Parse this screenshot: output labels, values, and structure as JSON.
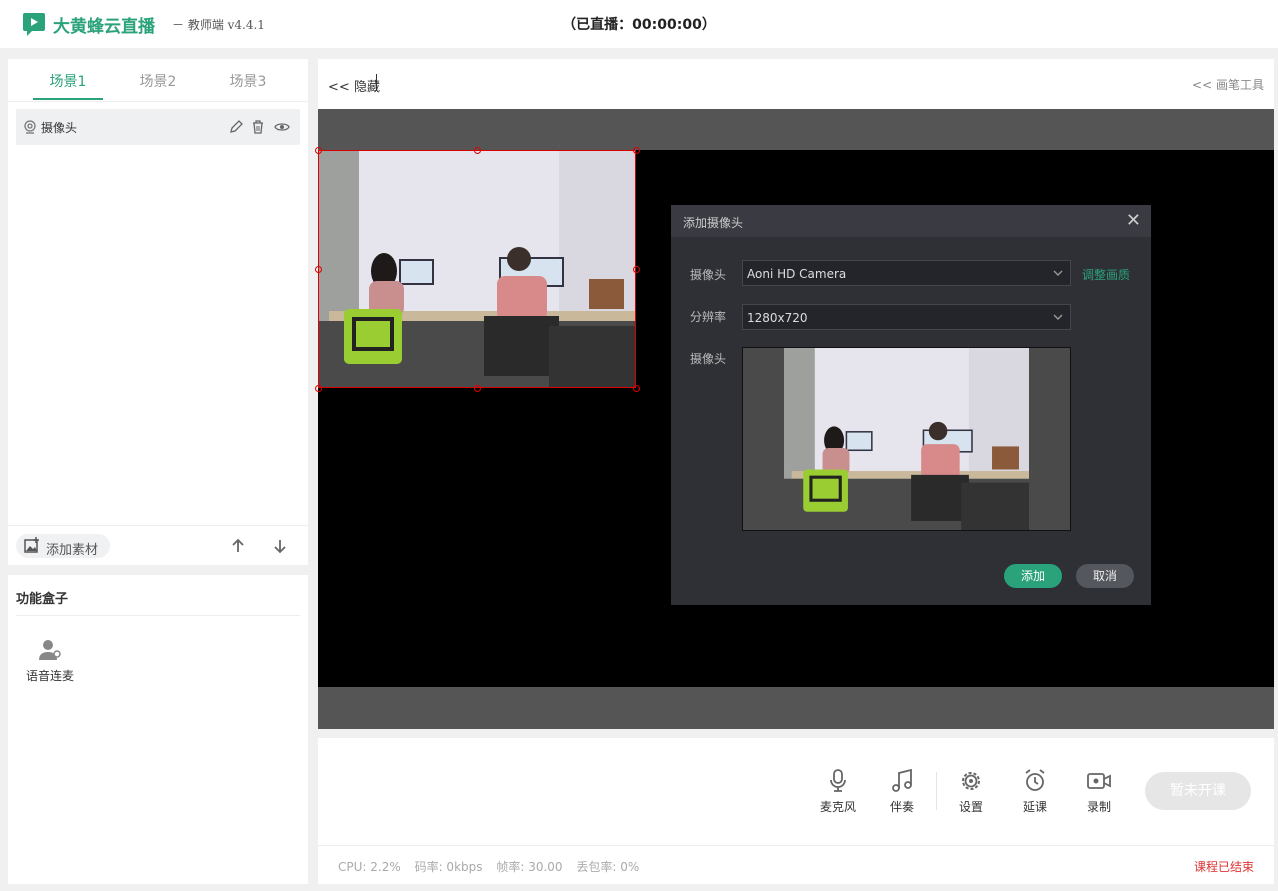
{
  "header": {
    "app_name": "大黄蜂云直播",
    "app_sub": "－ 教师端 v4.4.1",
    "live_status": "（已直播：00:00:00）"
  },
  "scenes": {
    "tabs": [
      "场景1",
      "场景2",
      "场景3"
    ],
    "active_tab": 0,
    "sources": [
      {
        "label": "摄像头",
        "icon": "camera-source-icon"
      }
    ],
    "add_material": "添加素材"
  },
  "func_box": {
    "title": "功能盒子",
    "items": [
      {
        "label": "语音连麦",
        "icon": "voice-connect-icon"
      }
    ]
  },
  "main": {
    "hide_label": "隐藏",
    "brush_tools": "画笔工具"
  },
  "dialog": {
    "title": "添加摄像头",
    "camera_label": "摄像头",
    "camera_value": "Aoni HD Camera",
    "adjust_link": "调整画质",
    "resolution_label": "分辨率",
    "resolution_value": "1280x720",
    "preview_label": "摄像头",
    "add_button": "添加",
    "cancel_button": "取消"
  },
  "controls": {
    "items": [
      {
        "label": "麦克风",
        "icon": "microphone-icon"
      },
      {
        "label": "伴奏",
        "icon": "music-icon"
      },
      {
        "label": "设置",
        "icon": "gear-icon"
      },
      {
        "label": "延课",
        "icon": "alarm-clock-icon"
      },
      {
        "label": "录制",
        "icon": "record-icon"
      }
    ],
    "start_button": "暂未开课"
  },
  "status": {
    "cpu": "CPU: 2.2%",
    "bitrate": "码率: 0kbps",
    "framerate": "帧率: 30.00",
    "packet_loss": "丢包率: 0%",
    "course_state": "课程已结束"
  },
  "colors": {
    "accent": "#2aa27a",
    "danger": "#d33333",
    "dialog_bg": "#2f3036"
  }
}
